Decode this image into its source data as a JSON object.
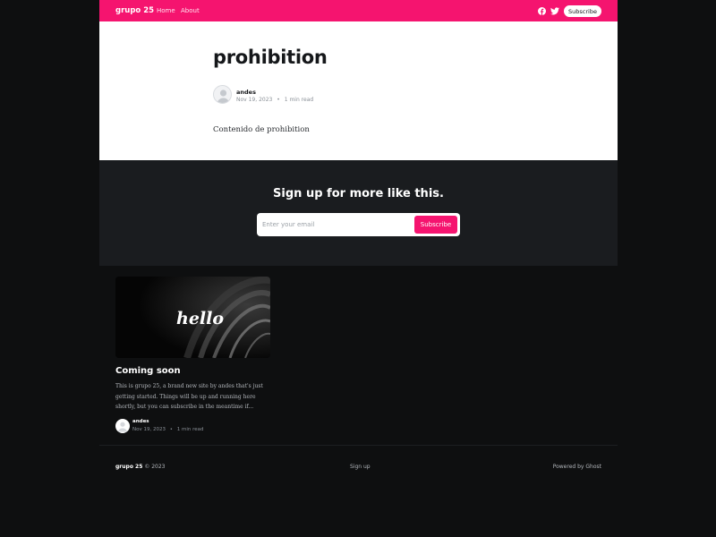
{
  "header": {
    "brand": "grupo 25",
    "nav": [
      "Home",
      "About"
    ],
    "icons": [
      "facebook-icon",
      "twitter-icon"
    ],
    "subscribe_label": "Subscribe",
    "accent_color": "#f5146f"
  },
  "article": {
    "title": "prohibition",
    "author": "andes",
    "date": "Nov 19, 2023",
    "read_time": "1 min read",
    "meta_separator": "•",
    "body": "Contenido de prohibition"
  },
  "signup": {
    "title": "Sign up for more like this.",
    "email_placeholder": "Enter your email",
    "button_label": "Subscribe"
  },
  "feed": {
    "card": {
      "image_text": "hello",
      "title": "Coming soon",
      "excerpt": "This is grupo 25, a brand new site by andes that's just getting started. Things will be up and running here shortly, but you can subscribe in the meantime if...",
      "author": "andes",
      "date": "Nov 19, 2023",
      "read_time": "1 min read"
    }
  },
  "footer": {
    "brand": "grupo 25",
    "copyright": "© 2023",
    "signup_link": "Sign up",
    "powered_by": "Powered by Ghost"
  }
}
